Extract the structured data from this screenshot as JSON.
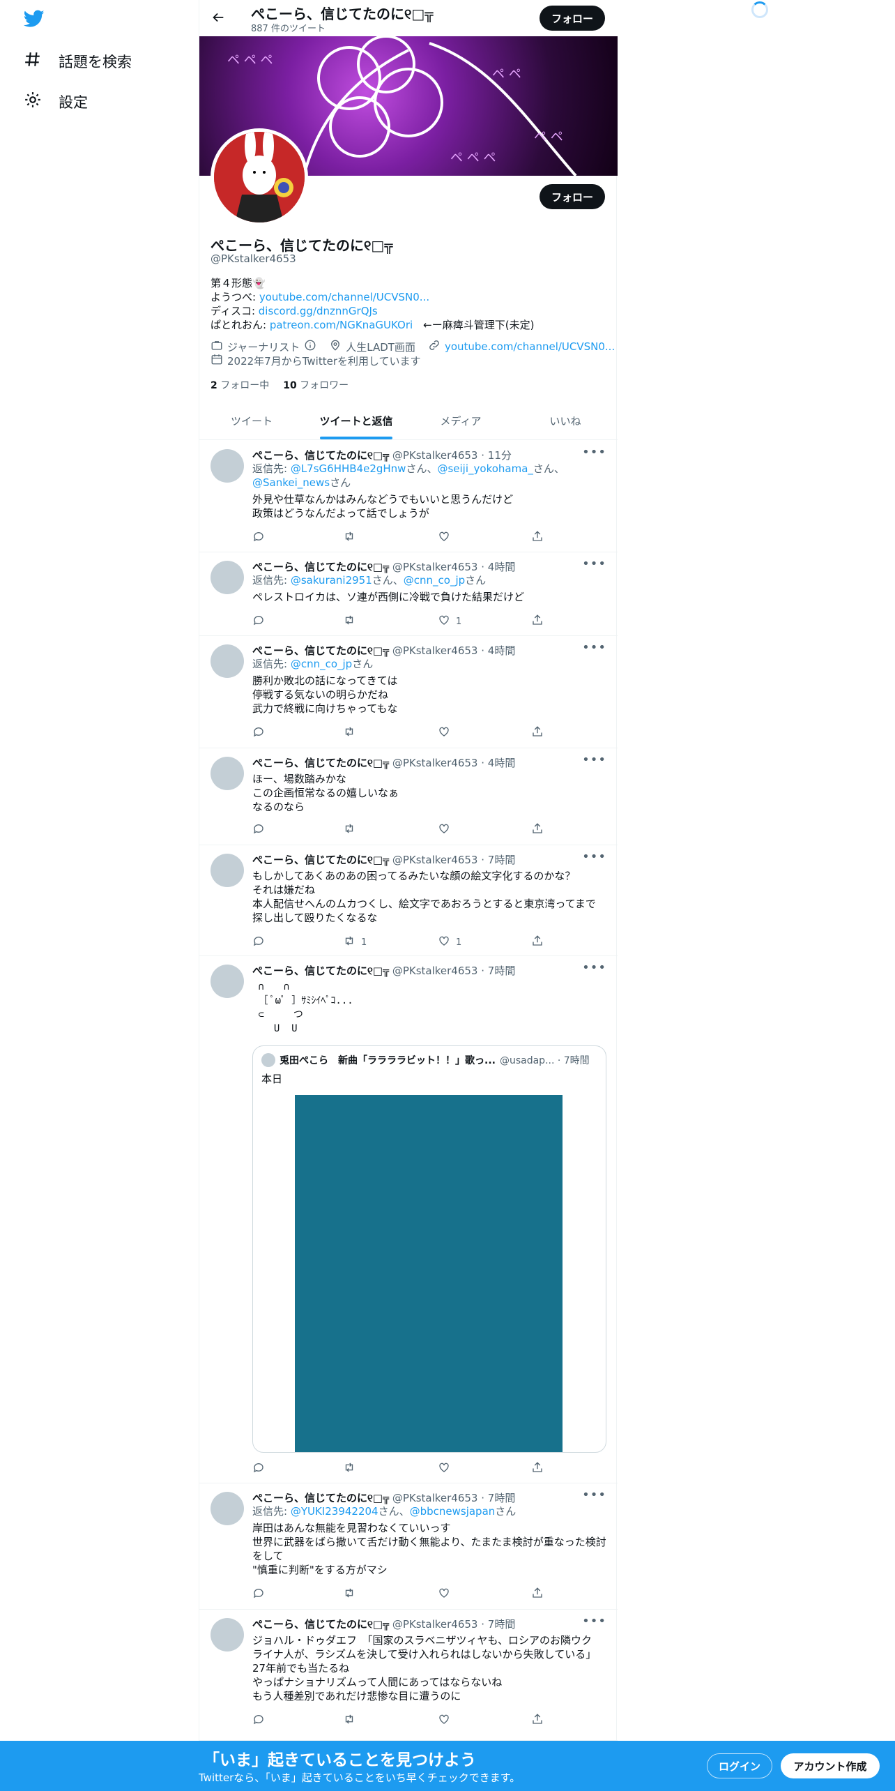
{
  "nav": {
    "explore_label": "話題を検索",
    "settings_label": "設定"
  },
  "header": {
    "name": "ぺこーら、信じてたのに୧□╦",
    "tweet_count": "887 件のツイート",
    "follow_label": "フォロー"
  },
  "profile": {
    "follow_label": "フォロー",
    "name": "ぺこーら、信じてたのに୧□╦",
    "handle": "@PKstalker4653",
    "bio_line1": "第４形態👻",
    "bio_youtube_label": "ようつべ: ",
    "bio_youtube_link": "youtube.com/channel/UCVSN0...",
    "bio_discord_label": "ディスコ: ",
    "bio_discord_link": "discord.gg/dnznnGrQJs",
    "bio_patreon_label": "ぱとれおん: ",
    "bio_patreon_link": "patreon.com/NGKnaGUKOri",
    "bio_patreon_note": "　←ー麻痺斗管理下(未定)",
    "category": "ジャーナリスト",
    "location": "人生LADT画面",
    "url": "youtube.com/channel/UCVSN0...",
    "joined": "2022年7月からTwitterを利用しています",
    "following_count": "2",
    "following_label": "フォロー中",
    "followers_count": "10",
    "followers_label": "フォロワー"
  },
  "tabs": [
    {
      "label": "ツイート"
    },
    {
      "label": "ツイートと返信"
    },
    {
      "label": "メディア"
    },
    {
      "label": "いいね"
    }
  ],
  "tweets": [
    {
      "name": "ぺこーら、信じてたのに୧□╦",
      "handle_time": "@PKstalker4653 · 11分",
      "reply_prefix": "返信先: ",
      "reply_1": "@L7sG6HHB4e2gHnw",
      "reply_sep_1": "さん、",
      "reply_2": "@seiji_yokohama_",
      "reply_sep_2": "さん、",
      "reply_3": "@Sankei_news",
      "reply_sep_3": "さん",
      "text": "外見や仕草なんかはみんなどうでもいいと思うんだけど\n政策はどうなんだよって話でしょうが",
      "retweets": "",
      "likes": ""
    },
    {
      "name": "ぺこーら、信じてたのに୧□╦",
      "handle_time": "@PKstalker4653 · 4時間",
      "reply_prefix": "返信先: ",
      "reply_1": "@sakurani2951",
      "reply_sep_1": "さん、",
      "reply_2": "@cnn_co_jp",
      "reply_sep_2": "さん",
      "text": "ペレストロイカは、ソ連が西側に冷戦で負けた結果だけど",
      "retweets": "",
      "likes": "1"
    },
    {
      "name": "ぺこーら、信じてたのに୧□╦",
      "handle_time": "@PKstalker4653 · 4時間",
      "reply_prefix": "返信先: ",
      "reply_1": "@cnn_co_jp",
      "reply_sep_1": "さん",
      "text": "勝利か敗北の話になってきては\n停戦する気ないの明らかだね\n武力で終戦に向けちゃってもな",
      "retweets": "",
      "likes": ""
    },
    {
      "name": "ぺこーら、信じてたのに୧□╦",
      "handle_time": "@PKstalker4653 · 4時間",
      "text": "ほー、場数踏みかな\nこの企画恒常なるの嬉しいなぁ\nなるのなら",
      "retweets": "",
      "likes": ""
    },
    {
      "name": "ぺこーら、信じてたのに୧□╦",
      "handle_time": "@PKstalker4653 · 7時間",
      "text": "もしかしてあくあのあの困ってるみたいな顔の絵文字化するのかな？\nそれは嫌だね\n本人配信せへんのムカつくし、絵文字であおろうとすると東京湾ってまで\n探し出して殴りたくなるな",
      "retweets": "1",
      "likes": "1"
    },
    {
      "name": "ぺこーら、信じてたのに୧□╦",
      "handle_time": "@PKstalker4653 · 7時間",
      "text": " ∩　　∩\n ［ ﾟωﾟ ］ｻﾐｼｲﾍﾟｺ...\n ⊂　　　つ\n 　 U  U",
      "quote_name": "兎田ぺこら　新曲「ララララビット！！」歌っ...",
      "quote_handle_time": "@usadap... · 7時間",
      "quote_text": "本日",
      "retweets": "",
      "likes": ""
    },
    {
      "name": "ぺこーら、信じてたのに୧□╦",
      "handle_time": "@PKstalker4653 · 7時間",
      "reply_prefix": "返信先: ",
      "reply_1": "@YUKI23942204",
      "reply_sep_1": "さん、",
      "reply_2": "@bbcnewsjapan",
      "reply_sep_2": "さん",
      "text": "岸田はあんな無能を見習わなくていいっす\n世界に武器をばら撒いて舌だけ動く無能より、たまたま検討が重なった検討\nをして\n\"慎重に判断\"をする方がマシ",
      "retweets": "",
      "likes": ""
    },
    {
      "name": "ぺこーら、信じてたのに୧□╦",
      "handle_time": "@PKstalker4653 · 7時間",
      "text": "ジョハル・ドゥダエフ　「国家のスラベニザツィヤも、ロシアのお隣ウク\nライナ人が、ラシズムを決して受け入れられはしないから失敗している」\n27年前でも当たるね\nやっぱナショナリズムって人間にあってはならないね\nもう人種差別であれだけ悲惨な目に遭うのに",
      "retweets": "",
      "likes": ""
    }
  ],
  "bottom": {
    "title": "「いま」起きていることを見つけよう",
    "subtitle": "Twitterなら、「いま」起きていることをいち早くチェックできます。",
    "login_label": "ログイン",
    "signup_label": "アカウント作成"
  },
  "colors": {
    "accent": "#1d9bf0",
    "text": "#0f1419",
    "muted": "#536471",
    "quote_image": "#17718c"
  }
}
